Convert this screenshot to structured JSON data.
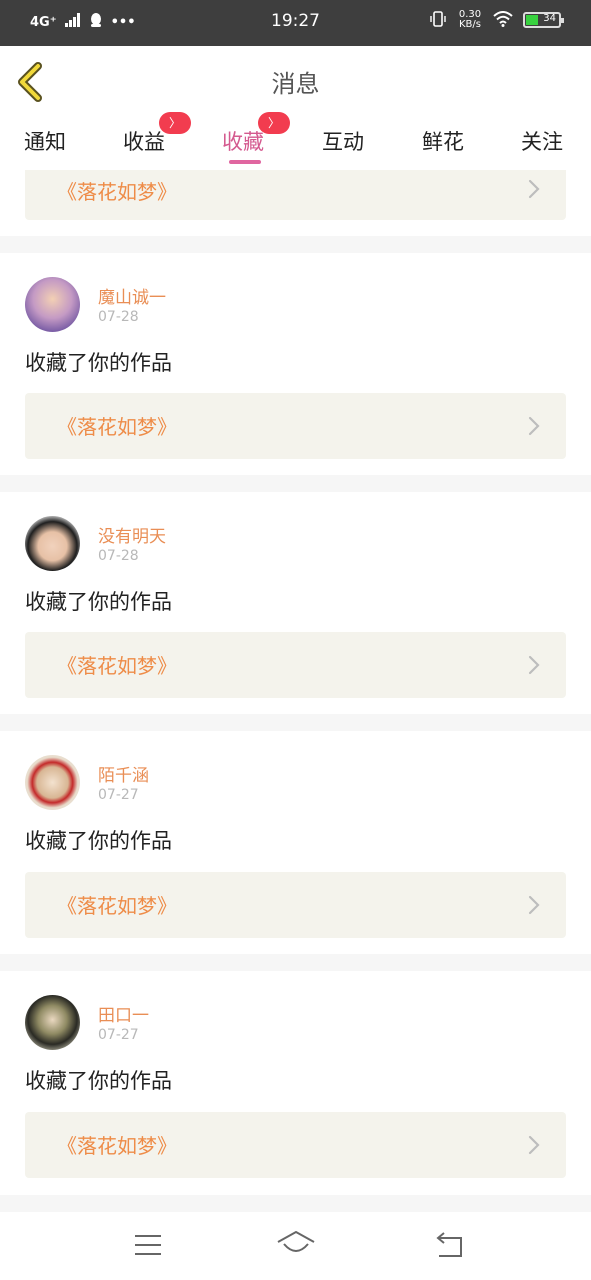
{
  "status_bar": {
    "network": "4G⁺",
    "time": "19:27",
    "speed": "0.30 KB/s",
    "battery": "34"
  },
  "header": {
    "title": "消息"
  },
  "tabs": [
    {
      "label": "通知",
      "badge": ""
    },
    {
      "label": "收益",
      "badge": "〉"
    },
    {
      "label": "收藏",
      "badge": "〉",
      "active": true
    },
    {
      "label": "互动",
      "badge": ""
    },
    {
      "label": "鲜花",
      "badge": ""
    },
    {
      "label": "关注",
      "badge": ""
    }
  ],
  "partial_card": {
    "work_title": "《落花如梦》"
  },
  "messages": [
    {
      "user": "魔山诚一",
      "date": "07-28",
      "text": "收藏了你的作品",
      "work_title": "《落花如梦》"
    },
    {
      "user": "没有明天",
      "date": "07-28",
      "text": "收藏了你的作品",
      "work_title": "《落花如梦》"
    },
    {
      "user": "陌千涵",
      "date": "07-27",
      "text": "收藏了你的作品",
      "work_title": "《落花如梦》"
    },
    {
      "user": "田口一",
      "date": "07-27",
      "text": "收藏了你的作品",
      "work_title": "《落花如梦》"
    }
  ],
  "colors": {
    "accent": "#e066a0",
    "username": "#e98e55",
    "work_title": "#ee8c48",
    "badge": "#f23c4f",
    "card_bg": "#f4f3ec"
  }
}
